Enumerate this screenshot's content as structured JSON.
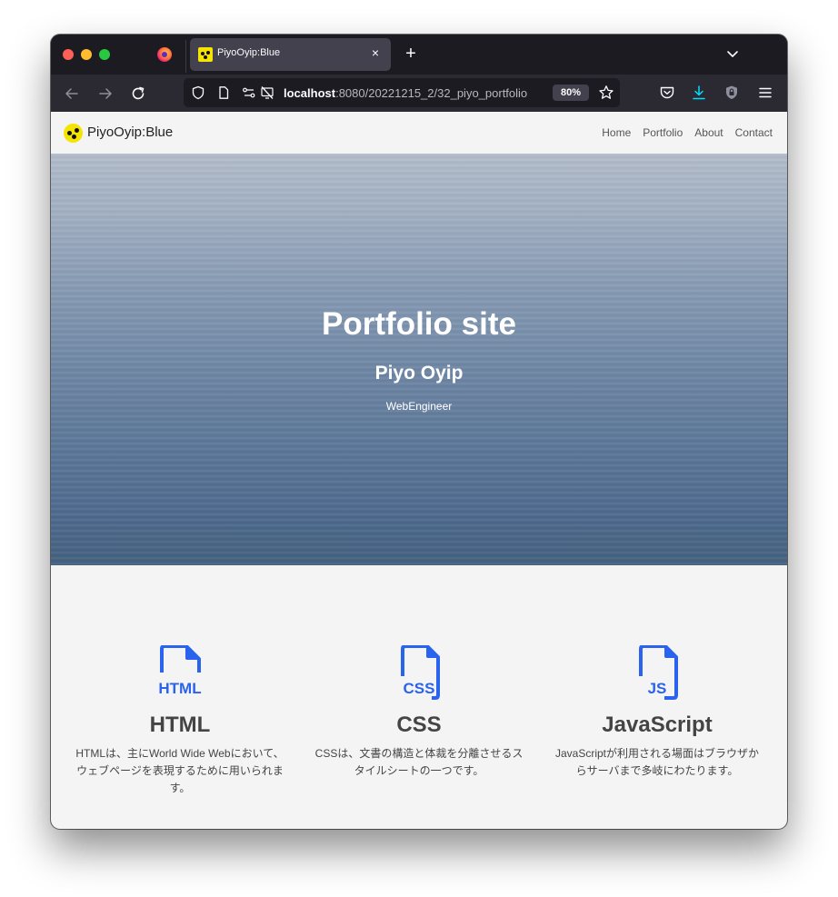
{
  "browser": {
    "tab_title": "PiyoOyip:Blue",
    "new_tab": "+",
    "close_glyph": "×",
    "url_host": "localhost",
    "url_path": ":8080/20221215_2/32_piyo_portfolio",
    "zoom": "80%",
    "accent": "#00ddff"
  },
  "site": {
    "name": "PiyoOyip:Blue",
    "nav": [
      "Home",
      "Portfolio",
      "About",
      "Contact"
    ]
  },
  "hero": {
    "title": "Portfolio site",
    "name": "Piyo Oyip",
    "role": "WebEngineer"
  },
  "skills": [
    {
      "icon": "filetype-html-icon",
      "ext": "HTML",
      "title": "HTML",
      "desc": "HTMLは、主にWorld Wide Webにおいて、ウェブページを表現するために用いられます。"
    },
    {
      "icon": "filetype-css-icon",
      "ext": "CSS",
      "title": "CSS",
      "desc": "CSSは、文書の構造と体裁を分離させるスタイルシートの一つです。"
    },
    {
      "icon": "filetype-js-icon",
      "ext": "JS",
      "title": "JavaScript",
      "desc": "JavaScriptが利用される場面はブラウザからサーバまで多岐にわたります。"
    }
  ],
  "colors": {
    "icon_blue": "#2a63ee",
    "hero_top": "#b2bccb",
    "hero_bottom": "#44617f"
  }
}
